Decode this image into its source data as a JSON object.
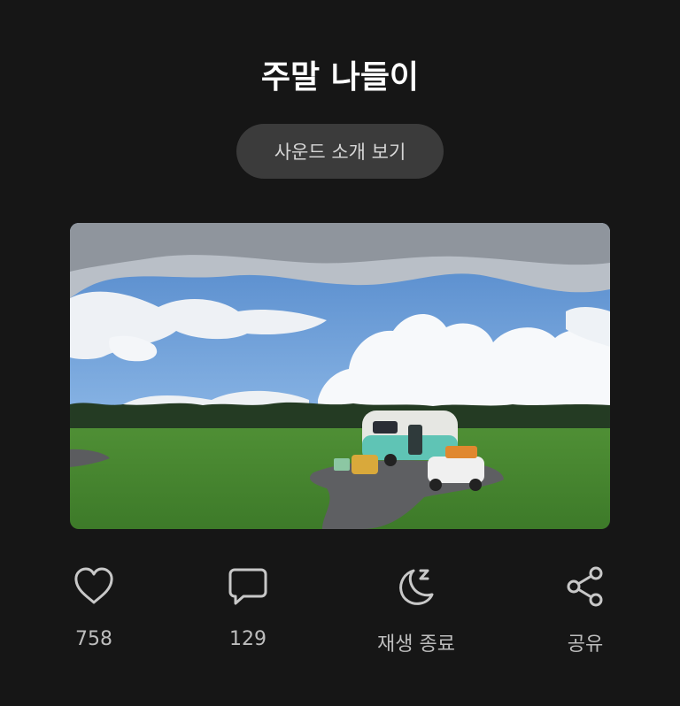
{
  "header": {
    "title": "주말 나들이"
  },
  "intro_button": {
    "label": "사운드 소개 보기"
  },
  "photo": {
    "subject": "camping-trailer-on-grass-field-image"
  },
  "actions": [
    {
      "icon": "heart-icon",
      "label": "758"
    },
    {
      "icon": "comment-icon",
      "label": "129"
    },
    {
      "icon": "moon-sleep-icon",
      "label": "재생 종료"
    },
    {
      "icon": "share-icon",
      "label": "공유"
    }
  ],
  "colors": {
    "background": "#161616",
    "button_bg": "#3b3b3b",
    "icon_color": "#c8c8c8",
    "label_color": "#bdbdbd"
  }
}
